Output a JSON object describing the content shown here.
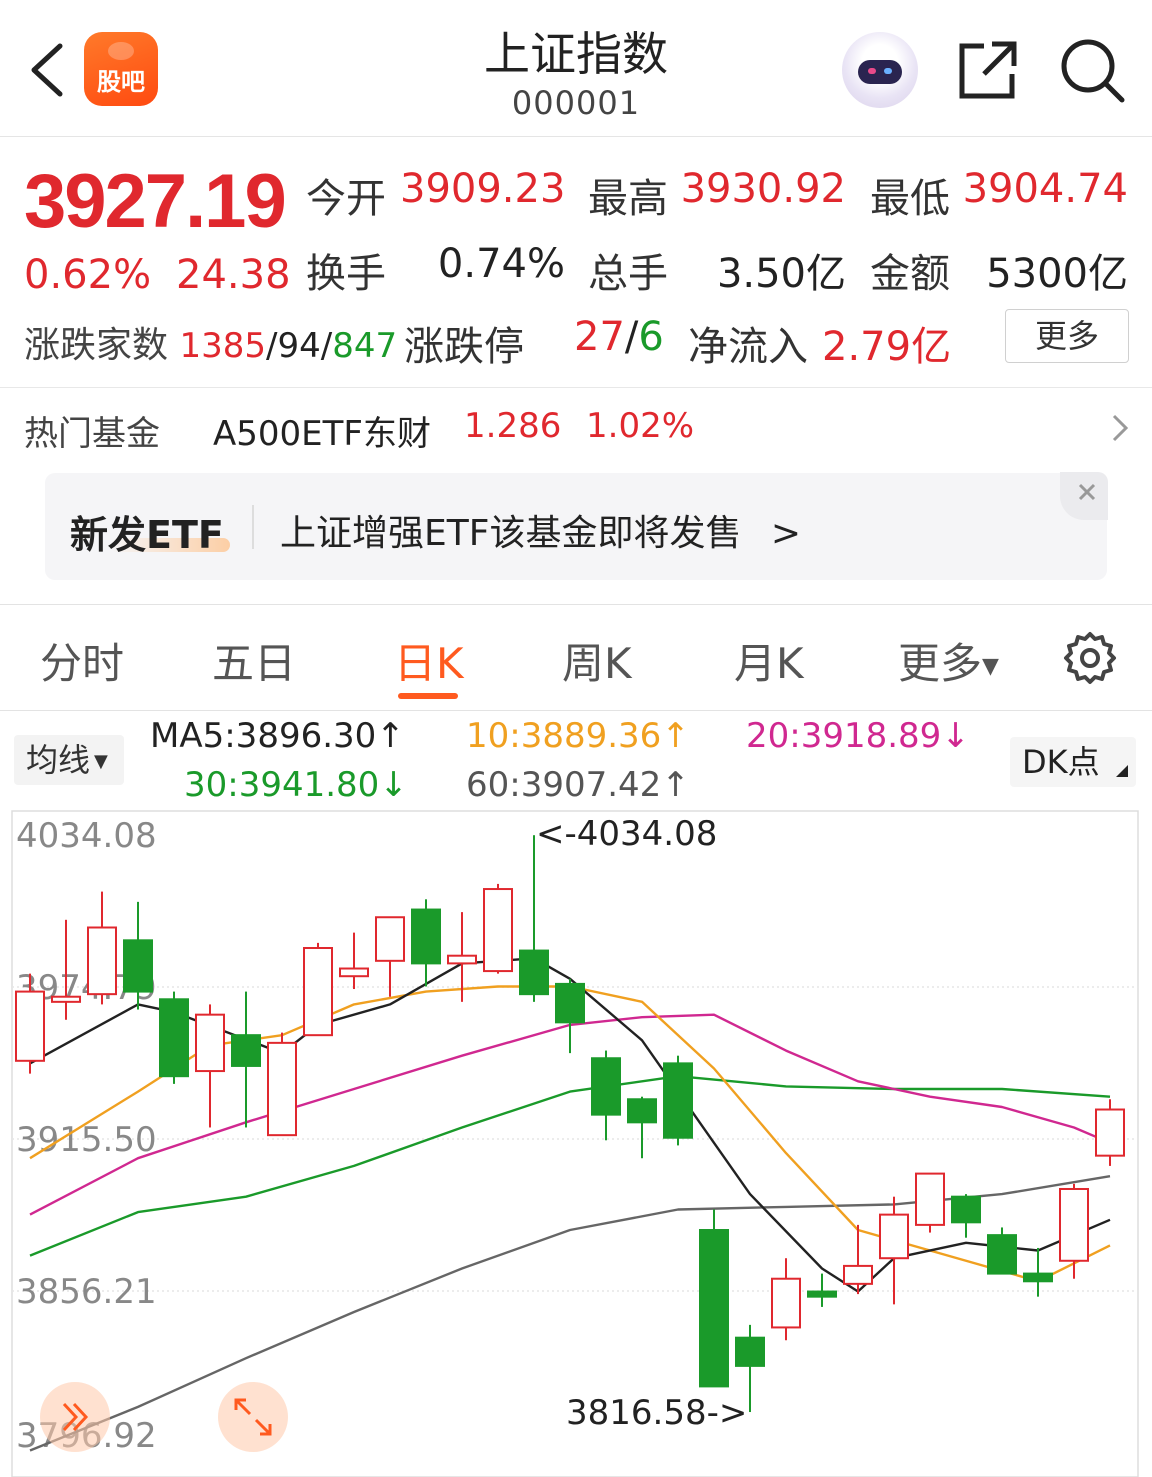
{
  "header": {
    "title": "上证指数",
    "code": "000001",
    "logo_text": "股吧"
  },
  "quote": {
    "price": "3927.19",
    "change_pct": "0.62%",
    "change": "24.38",
    "open_label": "今开",
    "open": "3909.23",
    "high_label": "最高",
    "high": "3930.92",
    "low_label": "最低",
    "low": "3904.74",
    "turnover_label": "换手",
    "turnover": "0.74%",
    "volume_label": "总手",
    "volume": "3.50亿",
    "amount_label": "金额",
    "amount": "5300亿",
    "updown_label": "涨跌家数",
    "up": "1385",
    "flat": "94",
    "down": "847",
    "limit_label": "涨跌停",
    "limit_up": "27",
    "limit_down": "6",
    "inflow_label": "净流入",
    "inflow": "2.79亿",
    "more": "更多"
  },
  "fund": {
    "label": "热门基金",
    "name": "A500ETF东财",
    "price": "1.286",
    "pct": "1.02%"
  },
  "banner": {
    "badge": "新发ETF",
    "text": "上证增强ETF该基金即将发售",
    "arrow": ">"
  },
  "tabs": [
    {
      "label": "分时"
    },
    {
      "label": "五日"
    },
    {
      "label": "日K"
    },
    {
      "label": "周K"
    },
    {
      "label": "月K"
    },
    {
      "label": "更多"
    }
  ],
  "ma_legend": {
    "select": "均线",
    "ma5": "MA5:3896.30↑",
    "ma10": "10:3889.36↑",
    "ma20": "20:3918.89↓",
    "ma30": "30:3941.80↓",
    "ma60": "60:3907.42↑",
    "dk": "DK点"
  },
  "colors": {
    "up": "#e0282e",
    "down": "#1a9a2a",
    "ma5": "#222222",
    "ma10": "#f0a020",
    "ma20": "#d02890",
    "ma30": "#1a9a2a",
    "ma60": "#666666",
    "accent": "#ff5a1f"
  },
  "chart_data": {
    "type": "candlestick",
    "y_ticks": [
      "4034.08",
      "3974.79",
      "3915.50",
      "3856.21",
      "3796.92"
    ],
    "ylim": [
      3796.92,
      4034.08
    ],
    "annotations": {
      "high": "<-4034.08",
      "low": "3816.58->"
    },
    "candles": [
      {
        "o": 3946,
        "c": 3973,
        "h": 3980,
        "l": 3941
      },
      {
        "o": 3969,
        "c": 3971,
        "h": 4001,
        "l": 3962
      },
      {
        "o": 3972,
        "c": 3998,
        "h": 4012,
        "l": 3968
      },
      {
        "o": 3993,
        "c": 3973,
        "h": 4008,
        "l": 3966
      },
      {
        "o": 3970,
        "c": 3940,
        "h": 3973,
        "l": 3937
      },
      {
        "o": 3942,
        "c": 3964,
        "h": 3968,
        "l": 3920
      },
      {
        "o": 3956,
        "c": 3944,
        "h": 3973,
        "l": 3920
      },
      {
        "o": 3917,
        "c": 3953,
        "h": 3957,
        "l": 3917
      },
      {
        "o": 3956,
        "c": 3990,
        "h": 3992,
        "l": 3957
      },
      {
        "o": 3979,
        "c": 3982,
        "h": 3996,
        "l": 3974
      },
      {
        "o": 3985,
        "c": 4002,
        "h": 4002,
        "l": 3971
      },
      {
        "o": 4005,
        "c": 3984,
        "h": 4009,
        "l": 3975
      },
      {
        "o": 3984,
        "c": 3987,
        "h": 4004,
        "l": 3969
      },
      {
        "o": 3981,
        "c": 4013,
        "h": 4015,
        "l": 3980
      },
      {
        "o": 3989,
        "c": 3972,
        "h": 4034,
        "l": 3969
      },
      {
        "o": 3976,
        "c": 3961,
        "h": 3978,
        "l": 3949
      },
      {
        "o": 3947,
        "c": 3925,
        "h": 3950,
        "l": 3915
      },
      {
        "o": 3931,
        "c": 3922,
        "h": 3932,
        "l": 3908
      },
      {
        "o": 3945,
        "c": 3916,
        "h": 3948,
        "l": 3913
      },
      {
        "o": 3880,
        "c": 3819,
        "h": 3888,
        "l": 3819
      },
      {
        "o": 3838,
        "c": 3827,
        "h": 3843,
        "l": 3809
      },
      {
        "o": 3842,
        "c": 3861,
        "h": 3869,
        "l": 3837
      },
      {
        "o": 3856,
        "c": 3854,
        "h": 3863,
        "l": 3850
      },
      {
        "o": 3859,
        "c": 3866,
        "h": 3882,
        "l": 3855
      },
      {
        "o": 3869,
        "c": 3886,
        "h": 3893,
        "l": 3851
      },
      {
        "o": 3882,
        "c": 3902,
        "h": 3902,
        "l": 3879
      },
      {
        "o": 3893,
        "c": 3883,
        "h": 3894,
        "l": 3877
      },
      {
        "o": 3878,
        "c": 3863,
        "h": 3881,
        "l": 3865
      },
      {
        "o": 3863,
        "c": 3860,
        "h": 3873,
        "l": 3854
      },
      {
        "o": 3868,
        "c": 3896,
        "h": 3898,
        "l": 3861
      },
      {
        "o": 3909,
        "c": 3927,
        "h": 3931,
        "l": 3905
      }
    ],
    "ma5": [
      [
        0,
        3945
      ],
      [
        3,
        3968
      ],
      [
        4,
        3965
      ],
      [
        7,
        3949
      ],
      [
        8,
        3960
      ],
      [
        10,
        3968
      ],
      [
        12,
        3984
      ],
      [
        14,
        3986
      ],
      [
        15,
        3978
      ],
      [
        17,
        3954
      ],
      [
        18,
        3934
      ],
      [
        20,
        3894
      ],
      [
        22,
        3865
      ],
      [
        23,
        3856
      ],
      [
        24,
        3869
      ],
      [
        26,
        3875
      ],
      [
        28,
        3872
      ],
      [
        30,
        3884
      ]
    ],
    "ma10": [
      [
        0,
        3908
      ],
      [
        3,
        3934
      ],
      [
        5,
        3952
      ],
      [
        7,
        3956
      ],
      [
        9,
        3968
      ],
      [
        11,
        3973
      ],
      [
        13,
        3975
      ],
      [
        15,
        3975
      ],
      [
        17,
        3969
      ],
      [
        19,
        3943
      ],
      [
        21,
        3910
      ],
      [
        23,
        3880
      ],
      [
        25,
        3872
      ],
      [
        27,
        3864
      ],
      [
        28,
        3860
      ],
      [
        30,
        3874
      ]
    ],
    "ma20": [
      [
        0,
        3886
      ],
      [
        3,
        3908
      ],
      [
        6,
        3922
      ],
      [
        9,
        3935
      ],
      [
        12,
        3948
      ],
      [
        15,
        3960
      ],
      [
        17,
        3963
      ],
      [
        19,
        3964
      ],
      [
        21,
        3950
      ],
      [
        23,
        3938
      ],
      [
        25,
        3932
      ],
      [
        27,
        3928
      ],
      [
        29,
        3920
      ],
      [
        30,
        3914
      ]
    ],
    "ma30": [
      [
        0,
        3870
      ],
      [
        3,
        3887
      ],
      [
        6,
        3893
      ],
      [
        9,
        3905
      ],
      [
        12,
        3920
      ],
      [
        15,
        3934
      ],
      [
        18,
        3940
      ],
      [
        21,
        3936
      ],
      [
        24,
        3935
      ],
      [
        27,
        3935
      ],
      [
        30,
        3932
      ]
    ],
    "ma60": [
      [
        0,
        3794
      ],
      [
        3,
        3811
      ],
      [
        6,
        3830
      ],
      [
        9,
        3848
      ],
      [
        12,
        3865
      ],
      [
        15,
        3880
      ],
      [
        18,
        3888
      ],
      [
        21,
        3889
      ],
      [
        24,
        3890
      ],
      [
        27,
        3894
      ],
      [
        30,
        3901
      ]
    ]
  }
}
